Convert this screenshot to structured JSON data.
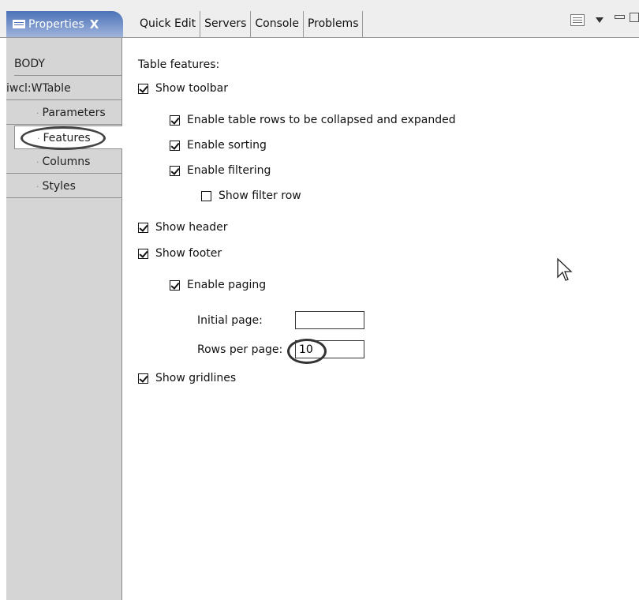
{
  "tabbar": {
    "active_tab": {
      "label": "Properties",
      "close_glyph": "X",
      "icon": "properties-view-icon"
    },
    "tabs": [
      {
        "label": "Quick Edit"
      },
      {
        "label": "Servers"
      },
      {
        "label": "Console"
      },
      {
        "label": "Problems"
      }
    ],
    "toolbar_icons": [
      "view-menu-icon",
      "chevron-down-icon",
      "minimize-icon",
      "maximize-icon"
    ]
  },
  "sidebar": {
    "items": [
      {
        "label": "BODY"
      },
      {
        "label": "iwcl:WTable"
      },
      {
        "label": "Parameters",
        "bullet": "·"
      },
      {
        "label": "Features",
        "bullet": "·",
        "selected": true
      },
      {
        "label": "Columns",
        "bullet": "·"
      },
      {
        "label": "Styles",
        "bullet": "·"
      }
    ]
  },
  "features": {
    "heading": "Table features:",
    "show_toolbar": {
      "label": "Show toolbar",
      "checked": true
    },
    "enable_collapse": {
      "label": "Enable table rows to be collapsed and expanded",
      "checked": true
    },
    "enable_sorting": {
      "label": "Enable sorting",
      "checked": true
    },
    "enable_filtering": {
      "label": "Enable filtering",
      "checked": true
    },
    "show_filter_row": {
      "label": "Show filter row",
      "checked": false
    },
    "show_header": {
      "label": "Show header",
      "checked": true
    },
    "show_footer": {
      "label": "Show footer",
      "checked": true
    },
    "enable_paging": {
      "label": "Enable paging",
      "checked": true
    },
    "initial_page": {
      "label": "Initial page:",
      "value": ""
    },
    "rows_per_page": {
      "label": "Rows per page:",
      "value": "10"
    },
    "show_gridlines": {
      "label": "Show gridlines",
      "checked": true
    }
  }
}
